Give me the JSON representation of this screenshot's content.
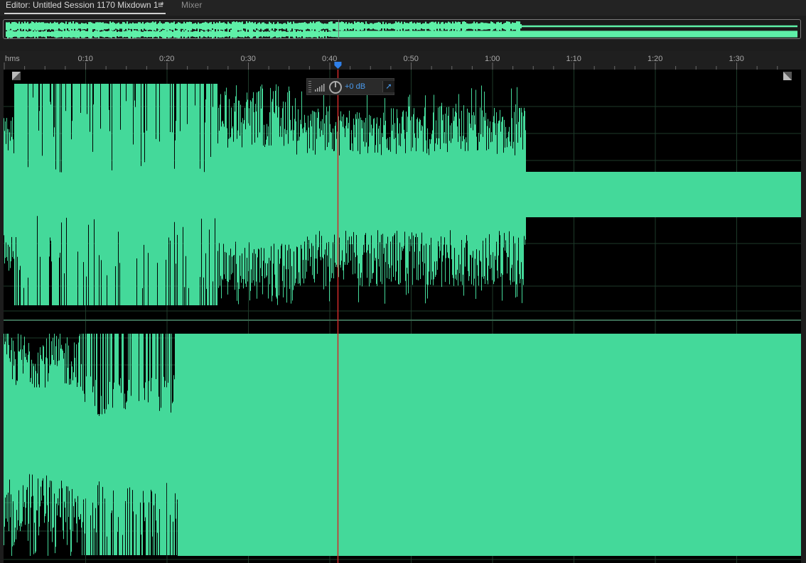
{
  "tabs": {
    "editor_label": "Editor: Untitled Session 1170 Mixdown 1 *",
    "menu_glyph": "≡",
    "mixer_label": "Mixer"
  },
  "ruler": {
    "unit_label": "hms",
    "ticks": [
      "0:10",
      "0:20",
      "0:30",
      "0:40",
      "0:50",
      "1:00",
      "1:10",
      "1:20",
      "1:30"
    ]
  },
  "playhead": {
    "time_seconds": 41
  },
  "hud": {
    "volume": "+0 dB"
  },
  "colors": {
    "waveform": "#44d99a",
    "overview_wave": "#5ef0a8",
    "playhead": "#d02a2a",
    "playhead_marker": "#2f7fe8",
    "background": "#000000",
    "grid": "#1e3a2a"
  },
  "icons": [
    "menu-icon",
    "level-meter-icon",
    "volume-knob-icon",
    "pin-icon",
    "fade-in-handle-icon",
    "fade-out-handle-icon",
    "playhead-marker-icon"
  ]
}
